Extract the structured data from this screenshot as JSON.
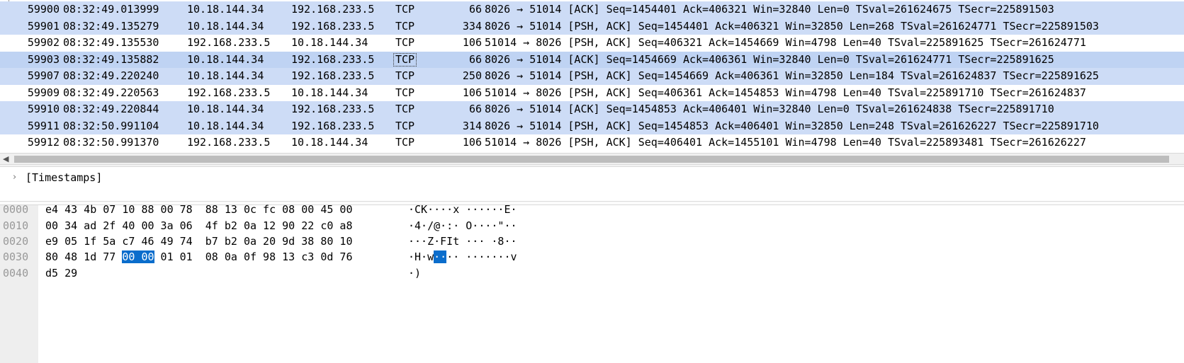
{
  "packets": [
    {
      "no": "59900",
      "time": "08:32:49.013999",
      "src": "10.18.144.34",
      "dst": "192.168.233.5",
      "proto": "TCP",
      "len": "66",
      "info": "8026 → 51014 [ACK] Seq=1454401 Ack=406321 Win=32840 Len=0 TSval=261624675 TSecr=225891503"
    },
    {
      "no": "59901",
      "time": "08:32:49.135279",
      "src": "10.18.144.34",
      "dst": "192.168.233.5",
      "proto": "TCP",
      "len": "334",
      "info": "8026 → 51014 [PSH, ACK] Seq=1454401 Ack=406321 Win=32850 Len=268 TSval=261624771 TSecr=225891503"
    },
    {
      "no": "59902",
      "time": "08:32:49.135530",
      "src": "192.168.233.5",
      "dst": "10.18.144.34",
      "proto": "TCP",
      "len": "106",
      "info": "51014 → 8026 [PSH, ACK] Seq=406321 Ack=1454669 Win=4798 Len=40 TSval=225891625 TSecr=261624771"
    },
    {
      "no": "59903",
      "time": "08:32:49.135882",
      "src": "10.18.144.34",
      "dst": "192.168.233.5",
      "proto": "TCP",
      "len": "66",
      "info": "8026 → 51014 [ACK] Seq=1454669 Ack=406361 Win=32840 Len=0 TSval=261624771 TSecr=225891625"
    },
    {
      "no": "59907",
      "time": "08:32:49.220240",
      "src": "10.18.144.34",
      "dst": "192.168.233.5",
      "proto": "TCP",
      "len": "250",
      "info": "8026 → 51014 [PSH, ACK] Seq=1454669 Ack=406361 Win=32850 Len=184 TSval=261624837 TSecr=225891625"
    },
    {
      "no": "59909",
      "time": "08:32:49.220563",
      "src": "192.168.233.5",
      "dst": "10.18.144.34",
      "proto": "TCP",
      "len": "106",
      "info": "51014 → 8026 [PSH, ACK] Seq=406361 Ack=1454853 Win=4798 Len=40 TSval=225891710 TSecr=261624837"
    },
    {
      "no": "59910",
      "time": "08:32:49.220844",
      "src": "10.18.144.34",
      "dst": "192.168.233.5",
      "proto": "TCP",
      "len": "66",
      "info": "8026 → 51014 [ACK] Seq=1454853 Ack=406401 Win=32840 Len=0 TSval=261624838 TSecr=225891710"
    },
    {
      "no": "59911",
      "time": "08:32:50.991104",
      "src": "10.18.144.34",
      "dst": "192.168.233.5",
      "proto": "TCP",
      "len": "314",
      "info": "8026 → 51014 [PSH, ACK] Seq=1454853 Ack=406401 Win=32850 Len=248 TSval=261626227 TSecr=225891710"
    },
    {
      "no": "59912",
      "time": "08:32:50.991370",
      "src": "192.168.233.5",
      "dst": "10.18.144.34",
      "proto": "TCP",
      "len": "106",
      "info": "51014 → 8026 [PSH, ACK] Seq=406401 Ack=1455101 Win=4798 Len=40 TSval=225893481 TSecr=261626227"
    }
  ],
  "details": {
    "expander": "›",
    "label": "[Timestamps]"
  },
  "bytes": {
    "offsets": [
      "0000",
      "0010",
      "0020",
      "0030",
      "0040"
    ],
    "lines": [
      {
        "hex_before": "e4 43 4b 07 10 88 00 78  88 13 0c fc 08 00 45 00",
        "hex_sel": "",
        "hex_after": "",
        "asc_before": "·CK····x ······E·",
        "asc_sel": "",
        "asc_after": ""
      },
      {
        "hex_before": "00 34 ad 2f 40 00 3a 06  4f b2 0a 12 90 22 c0 a8",
        "hex_sel": "",
        "hex_after": "",
        "asc_before": "·4·/@·:· O····\"··",
        "asc_sel": "",
        "asc_after": ""
      },
      {
        "hex_before": "e9 05 1f 5a c7 46 49 74  b7 b2 0a 20 9d 38 80 10",
        "hex_sel": "",
        "hex_after": "",
        "asc_before": "···Z·FIt ··· ·8··",
        "asc_sel": "",
        "asc_after": ""
      },
      {
        "hex_before": "80 48 1d 77 ",
        "hex_sel": "00 00",
        "hex_after": " 01 01  08 0a 0f 98 13 c3 0d 76",
        "asc_before": "·H·w",
        "asc_sel": "··",
        "asc_after": "·· ·······v"
      },
      {
        "hex_before": "d5 29",
        "hex_sel": "",
        "hex_after": "",
        "asc_before": "·)",
        "asc_sel": "",
        "asc_after": ""
      }
    ]
  },
  "colors": {
    "row_highlight": "#cddcf6",
    "row_selected": "#bfd3f3",
    "byte_selection": "#0a6dcc"
  }
}
